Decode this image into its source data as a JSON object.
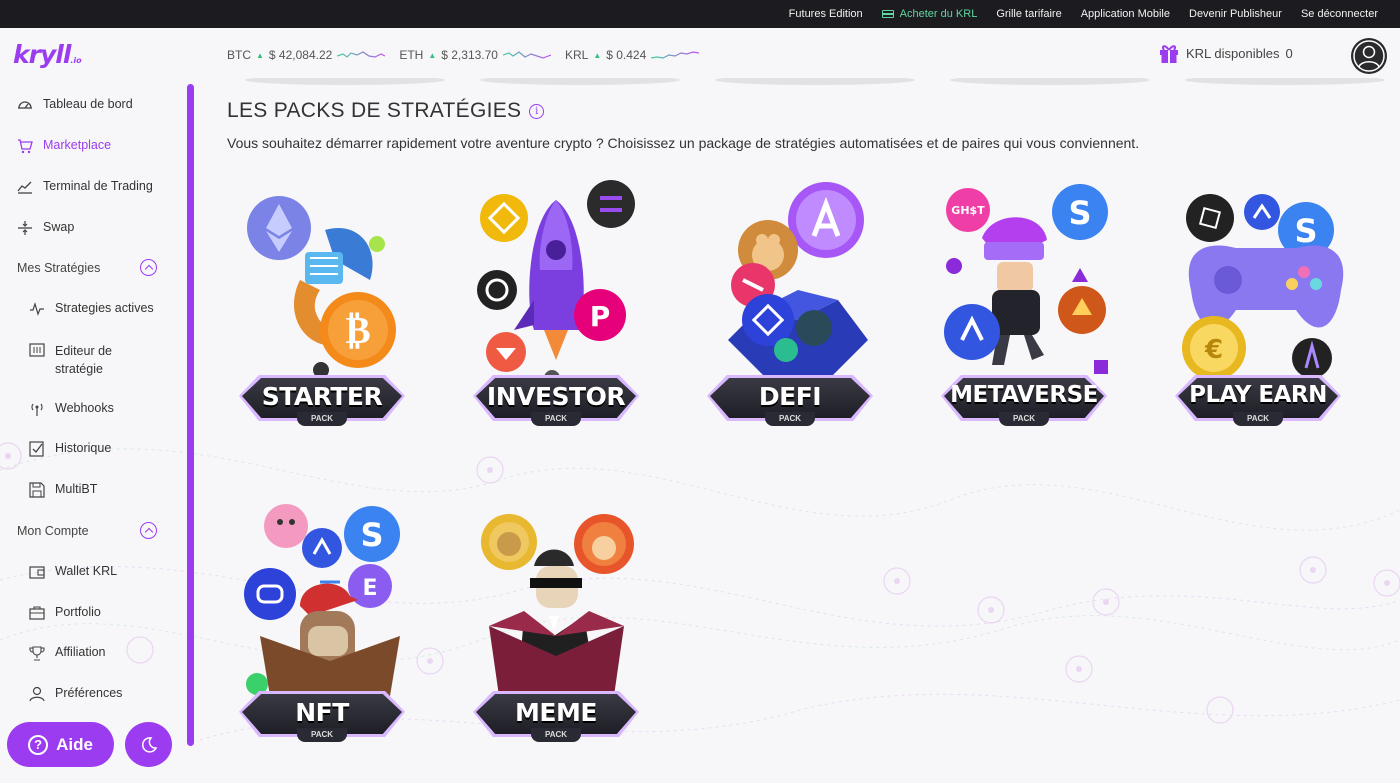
{
  "topnav": {
    "futures": "Futures Edition",
    "buy_krl": "Acheter du KRL",
    "pricing": "Grille tarifaire",
    "mobile_app": "Application Mobile",
    "publisher": "Devenir Publisheur",
    "logout": "Se déconnecter"
  },
  "brand": {
    "logo": "kryll",
    "logo_suffix": ".io",
    "accent": "#9b3cf0"
  },
  "ticker": [
    {
      "symbol": "BTC",
      "price": "$ 42,084.22"
    },
    {
      "symbol": "ETH",
      "price": "$ 2,313.70"
    },
    {
      "symbol": "KRL",
      "price": "$ 0.424"
    }
  ],
  "krl_available": {
    "label": "KRL disponibles",
    "value": "0"
  },
  "sidebar": {
    "items": [
      {
        "label": "Tableau de bord",
        "icon": "dashboard-icon"
      },
      {
        "label": "Marketplace",
        "icon": "cart-icon",
        "active": true
      },
      {
        "label": "Terminal de Trading",
        "icon": "chart-line-icon"
      },
      {
        "label": "Swap",
        "icon": "swap-icon"
      }
    ],
    "section_strategies": "Mes Stratégies",
    "strategies": [
      {
        "label": "Strategies actives",
        "icon": "pulse-icon"
      },
      {
        "label": "Editeur de",
        "label2": "stratégie",
        "icon": "editor-icon"
      },
      {
        "label": "Webhooks",
        "icon": "antenna-icon"
      },
      {
        "label": "Historique",
        "icon": "checklist-icon"
      },
      {
        "label": "MultiBT",
        "icon": "floppy-icon"
      }
    ],
    "section_account": "Mon Compte",
    "account": [
      {
        "label": "Wallet KRL",
        "icon": "wallet-icon"
      },
      {
        "label": "Portfolio",
        "icon": "briefcase-icon"
      },
      {
        "label": "Affiliation",
        "icon": "trophy-icon"
      },
      {
        "label": "Préférences",
        "icon": "user-icon"
      }
    ],
    "help": "Aide"
  },
  "main": {
    "title": "LES PACKS DE STRATÉGIES",
    "subtitle": "Vous souhaitez démarrer rapidement votre aventure crypto ? Choisissez un package de stratégies automatisées et de paires qui vous conviennent.",
    "pack_sub": "PACK",
    "packs": [
      {
        "name": "STARTER"
      },
      {
        "name": "INVESTOR"
      },
      {
        "name": "DEFI"
      },
      {
        "name": "METAVERSE"
      },
      {
        "name": "PLAY EARN"
      },
      {
        "name": "NFT"
      },
      {
        "name": "MEME"
      }
    ]
  }
}
